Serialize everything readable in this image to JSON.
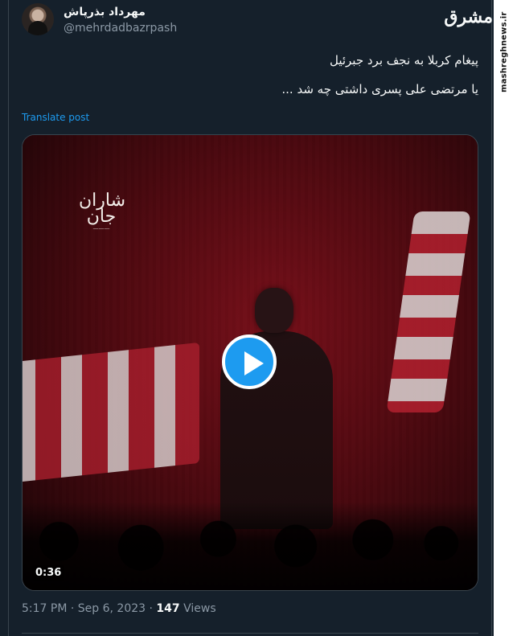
{
  "tweet": {
    "display_name": "مهرداد بذرپاش",
    "handle": "@mehrdadbazrpash",
    "text_line_1": "پیغام کربلا به نجف برد جبرئیل",
    "text_line_2": "یا مرتضی علی پسری داشتی چه شد ...",
    "translate_label": "Translate post",
    "time": "5:17 PM",
    "separator": "·",
    "date": "Sep 6, 2023",
    "views_count": "147",
    "views_label": "Views"
  },
  "media": {
    "duration": "0:36",
    "video_logo_text": "شاران جان",
    "state": "paused"
  },
  "watermark": {
    "logo_text": "مشرق",
    "site": "mashreghnews.ir"
  },
  "colors": {
    "background": "#15202b",
    "text_primary": "#f7f9f9",
    "text_secondary": "#8b98a5",
    "accent_blue": "#1d9bf0",
    "border": "#38444d"
  },
  "icons": {
    "play": "play-icon"
  }
}
